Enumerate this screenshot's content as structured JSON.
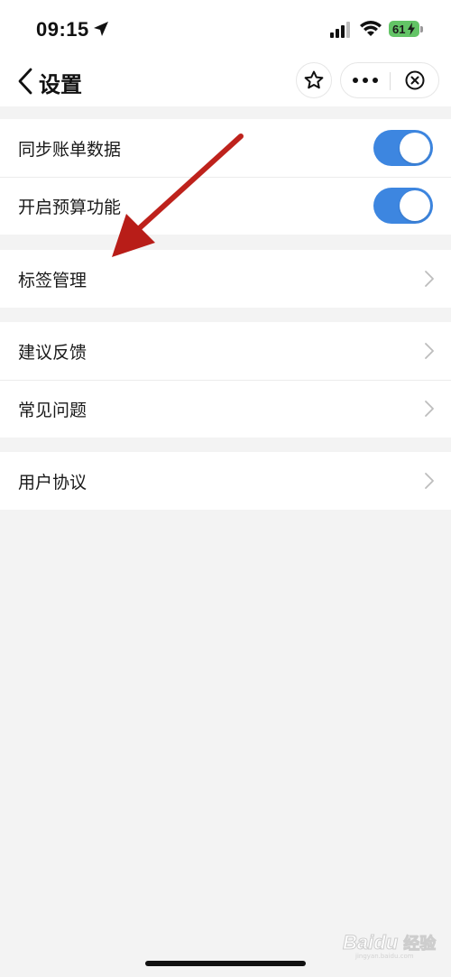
{
  "status_bar": {
    "time": "09:15",
    "battery": "61"
  },
  "nav": {
    "title": "设置"
  },
  "sections": [
    {
      "items": [
        {
          "label": "同步账单数据",
          "type": "toggle",
          "on": true
        },
        {
          "label": "开启预算功能",
          "type": "toggle",
          "on": true
        }
      ]
    },
    {
      "items": [
        {
          "label": "标签管理",
          "type": "link"
        }
      ]
    },
    {
      "items": [
        {
          "label": "建议反馈",
          "type": "link"
        },
        {
          "label": "常见问题",
          "type": "link"
        }
      ]
    },
    {
      "items": [
        {
          "label": "用户协议",
          "type": "link"
        }
      ]
    }
  ],
  "watermark": {
    "text": "Bai",
    "suffix": "经验",
    "url": "jingyan.baidu.com"
  },
  "colors": {
    "toggle_on": "#3d86e0",
    "annotation_arrow": "#c0201e",
    "battery": "#63c466"
  }
}
